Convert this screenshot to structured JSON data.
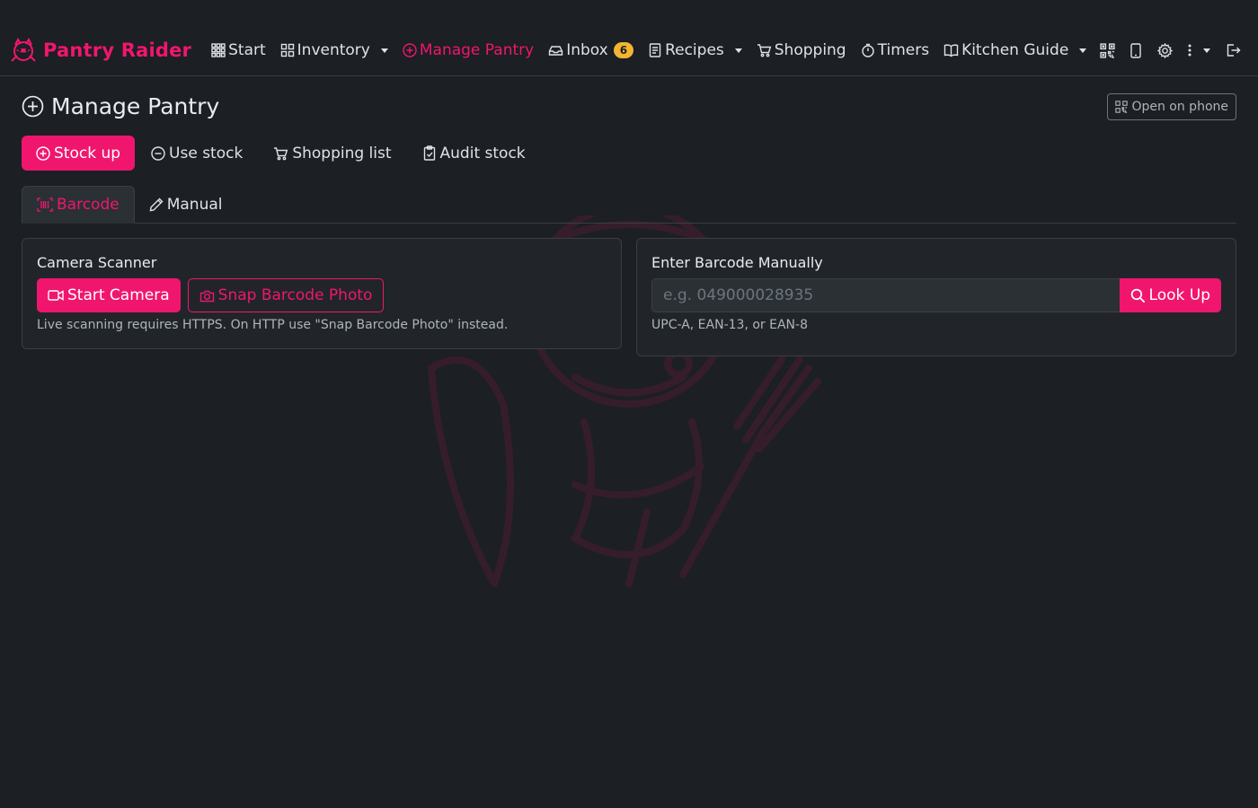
{
  "brand": {
    "name": "Pantry Raider"
  },
  "nav": {
    "items": [
      {
        "label": "Start"
      },
      {
        "label": "Inventory"
      },
      {
        "label": "Manage Pantry"
      },
      {
        "label": "Inbox",
        "badge": "6"
      },
      {
        "label": "Recipes"
      },
      {
        "label": "Shopping"
      },
      {
        "label": "Timers"
      },
      {
        "label": "Kitchen Guide"
      }
    ],
    "right_icons": [
      "qr-code-icon",
      "phone-icon",
      "gear-icon",
      "more-vertical-icon",
      "logout-icon"
    ]
  },
  "page": {
    "title": "Manage Pantry",
    "open_on_phone": "Open on phone"
  },
  "modes": {
    "stock_up": "Stock up",
    "use_stock": "Use stock",
    "shopping_list": "Shopping list",
    "audit_stock": "Audit stock"
  },
  "tabs": {
    "barcode": "Barcode",
    "manual": "Manual"
  },
  "camera": {
    "title": "Camera Scanner",
    "start_camera": "Start Camera",
    "snap_photo": "Snap Barcode Photo",
    "hint": "Live scanning requires HTTPS. On HTTP use \"Snap Barcode Photo\" instead."
  },
  "manual_entry": {
    "title": "Enter Barcode Manually",
    "placeholder": "e.g. 049000028935",
    "value": "",
    "lookup": "Look Up",
    "hint": "UPC-A, EAN-13, or EAN-8"
  },
  "colors": {
    "accent": "#f0166e",
    "badge": "#f2b530",
    "background": "#1c1f23"
  }
}
